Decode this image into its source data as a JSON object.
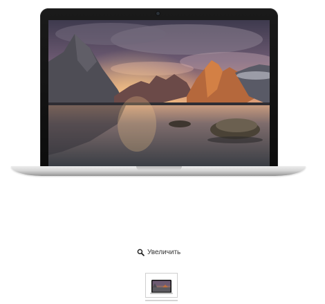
{
  "product_gallery": {
    "main_image_name": "macbook-pro-laptop",
    "zoom": {
      "label": "Увеличить",
      "icon": "magnifier-icon"
    },
    "thumbnails": [
      {
        "name": "thumbnail-macbook",
        "selected": true
      }
    ]
  }
}
